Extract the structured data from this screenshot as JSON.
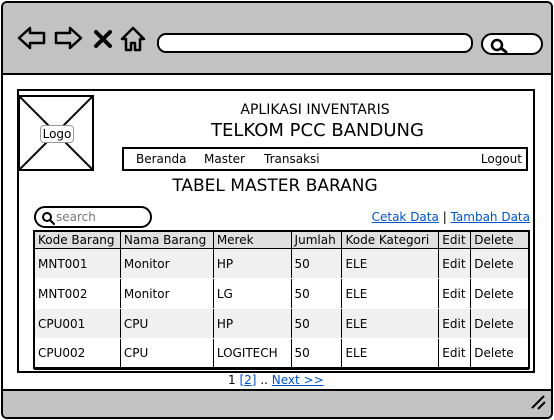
{
  "header": {
    "app_title": "APLIKASI INVENTARIS",
    "app_subtitle": "TELKOM PCC BANDUNG",
    "logo_label": "Logo"
  },
  "menu": {
    "items": [
      {
        "label": "Beranda"
      },
      {
        "label": "Master"
      },
      {
        "label": "Transaksi"
      }
    ],
    "logout": "Logout"
  },
  "main": {
    "table_title": "TABEL MASTER BARANG",
    "search_placeholder": "search",
    "cetak": "Cetak Data",
    "separator": "|",
    "tambah": "Tambah Data"
  },
  "table": {
    "columns": [
      "Kode Barang",
      "Nama Barang",
      "Merek",
      "Jumlah",
      "Kode Kategori",
      "Edit",
      "Delete"
    ],
    "rows": [
      [
        "MNT001",
        "Monitor",
        "HP",
        "50",
        "ELE",
        "Edit",
        "Delete"
      ],
      [
        "MNT002",
        "Monitor",
        "LG",
        "50",
        "ELE",
        "Edit",
        "Delete"
      ],
      [
        "CPU001",
        "CPU",
        "HP",
        "50",
        "ELE",
        "Edit",
        "Delete"
      ],
      [
        "CPU002",
        "CPU",
        "LOGITECH",
        "50",
        "ELE",
        "Edit",
        "Delete"
      ]
    ]
  },
  "pager": {
    "current": "1",
    "page2": "2",
    "ellipsis": "..",
    "next": "Next >>"
  }
}
